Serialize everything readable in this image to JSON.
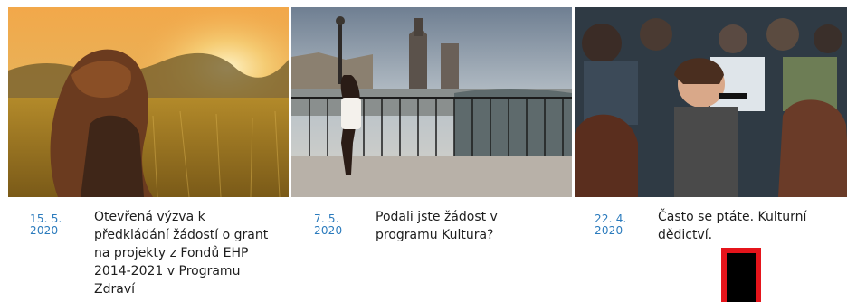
{
  "news": [
    {
      "date_line1": "15. 5.",
      "date_line2": "2020",
      "title": "Otevřená výzva k předkládání žádostí o grant na projekty z Fondů EHP 2014-2021 v Programu Zdraví"
    },
    {
      "date_line1": "7. 5.",
      "date_line2": "2020",
      "title": "Podali jste žádost v programu Kultura?"
    },
    {
      "date_line1": "22. 4.",
      "date_line2": "2020",
      "title": "Často se ptáte. Kulturní dědictví."
    }
  ],
  "colors": {
    "date": "#2b7bbd",
    "title": "#1d1d1d",
    "marker_border": "#e5141b",
    "marker_fill": "#000000"
  }
}
